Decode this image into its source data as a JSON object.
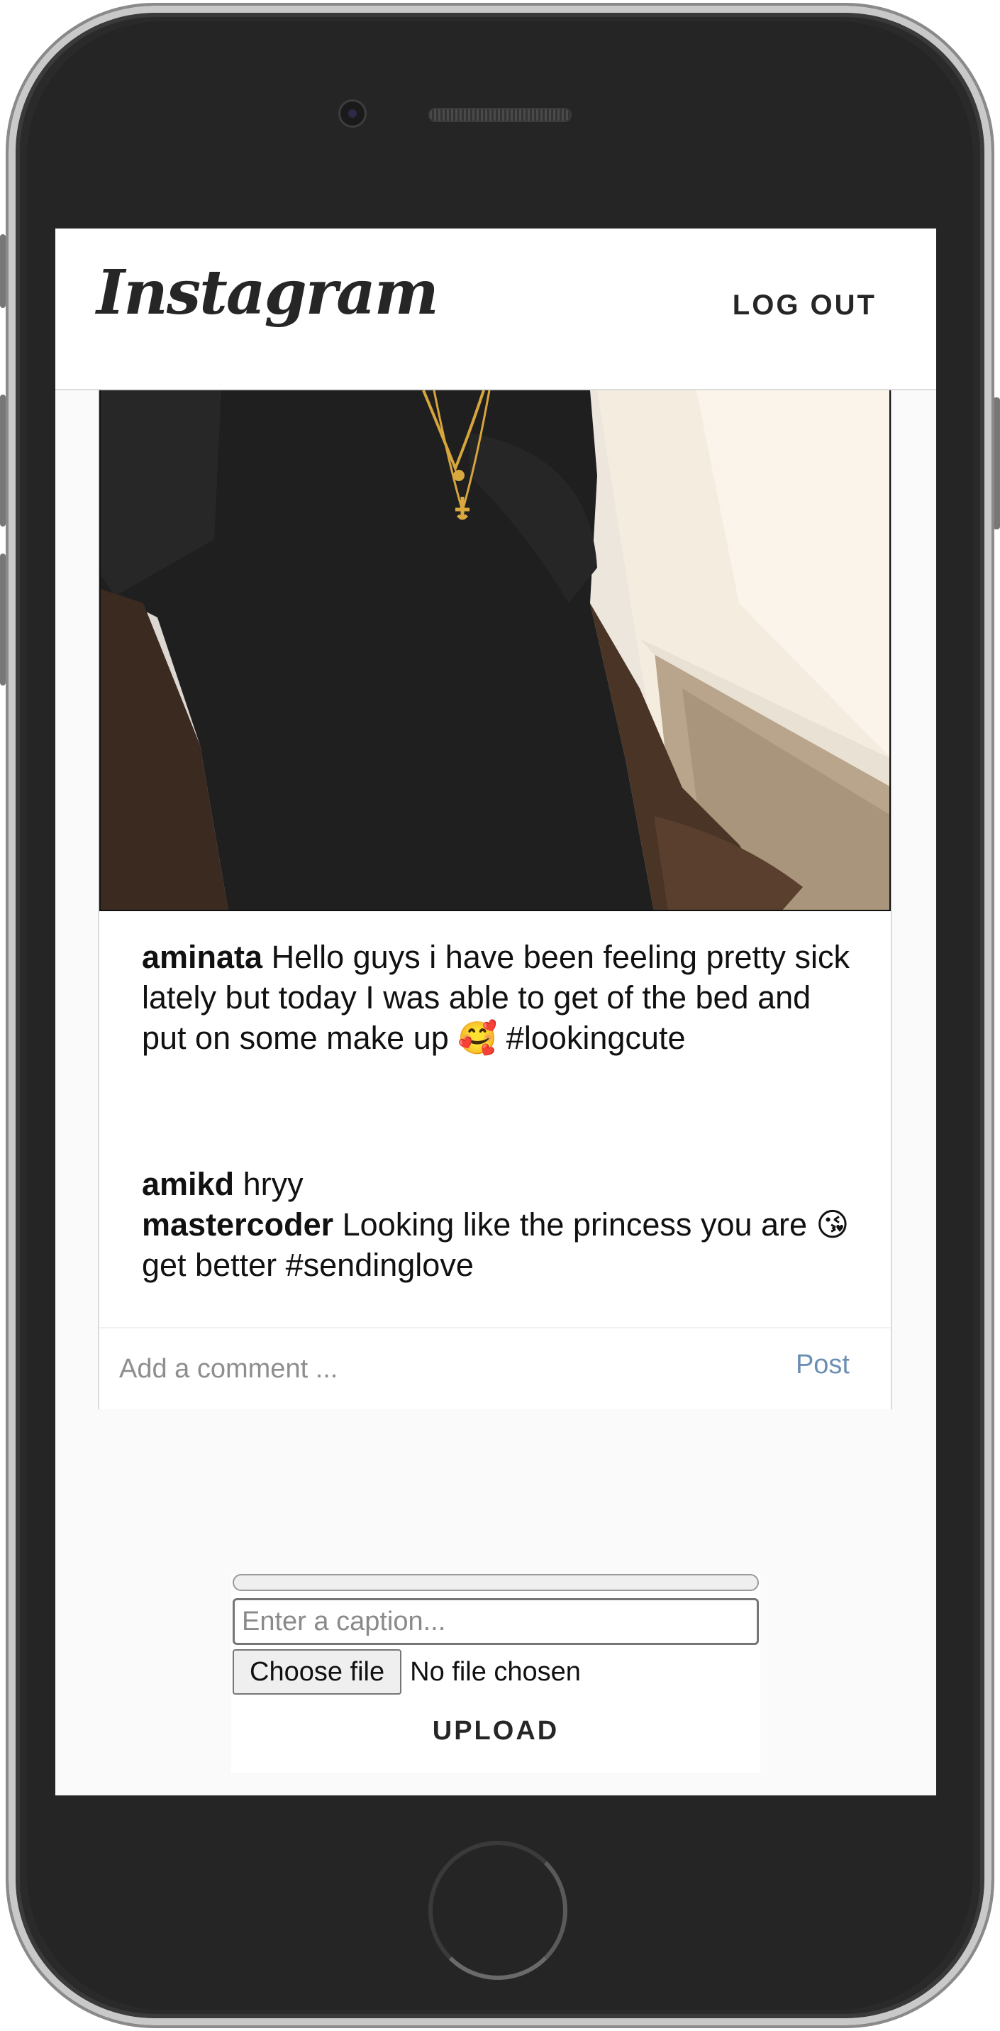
{
  "header": {
    "logo_text": "Instagram",
    "logout_label": "LOG OUT"
  },
  "post": {
    "author": "aminata",
    "caption": "Hello guys i have been feeling pretty sick lately but today I was able to get of the bed and put on some make up 🥰 #lookingcute",
    "comments": [
      {
        "username": "amikd",
        "text": "hryy"
      },
      {
        "username": "mastercoder",
        "text": "Looking like the princess you are 😘 get better #sendinglove"
      }
    ],
    "comment_placeholder": "Add a comment ...",
    "post_label": "Post"
  },
  "upload": {
    "progress_percent": 0,
    "caption_placeholder": "Enter a caption...",
    "choose_file_label": "Choose file",
    "file_status": "No file chosen",
    "upload_label": "UPLOAD"
  },
  "colors": {
    "post_link": "#6b8fb3",
    "text": "#111111",
    "border": "#dbdbdb"
  }
}
